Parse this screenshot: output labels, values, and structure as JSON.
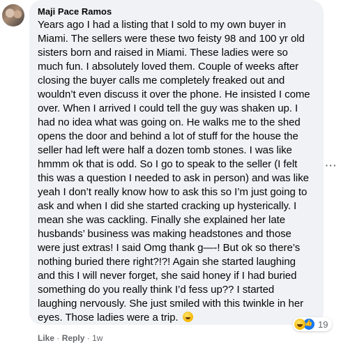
{
  "comment": {
    "author": "Maji Pace Ramos",
    "text": "Years ago I had a listing that I sold to my own buyer in Miami. The sellers were these two feisty 98 and 100 yr old sisters born and raised in Miami. These ladies were so much fun. I absolutely loved them. Couple of weeks after closing the buyer calls me completely freaked out and wouldn’t even discuss it over the phone. He insisted I come over. When I arrived I could tell the guy was shaken up. I had no idea what was going on. He walks me to the shed opens the door and behind a lot of stuff for the house the seller had left were half a dozen tomb stones. I was like hmmm ok that is odd. So I go to speak to the seller (I felt this was a question I needed to ask in person) and was like yeah I don’t really know how to ask this so I’m just going to ask and when I did she started cracking up hysterically. I mean she was cackling. Finally she explained her late husbands’ business was making headstones and those were just extras! I said Omg thank g—-! But ok so there’s nothing buried there right?!?! Again she started laughing and this I will never forget, she said honey if I had buried something do you really think I’d fess up?? I started laughing nervously. She just smiled with this twinkle in her eyes. Those ladies were a trip.",
    "trailing_emoji": "rolling-on-floor-laughing-emoji",
    "reactions": {
      "icons": [
        "haha-reaction-icon",
        "like-reaction-icon"
      ],
      "count": "19"
    },
    "actions": {
      "like": "Like",
      "sep1": "·",
      "reply": "Reply",
      "sep2": "·",
      "time": "1w"
    },
    "more_label": "···"
  }
}
